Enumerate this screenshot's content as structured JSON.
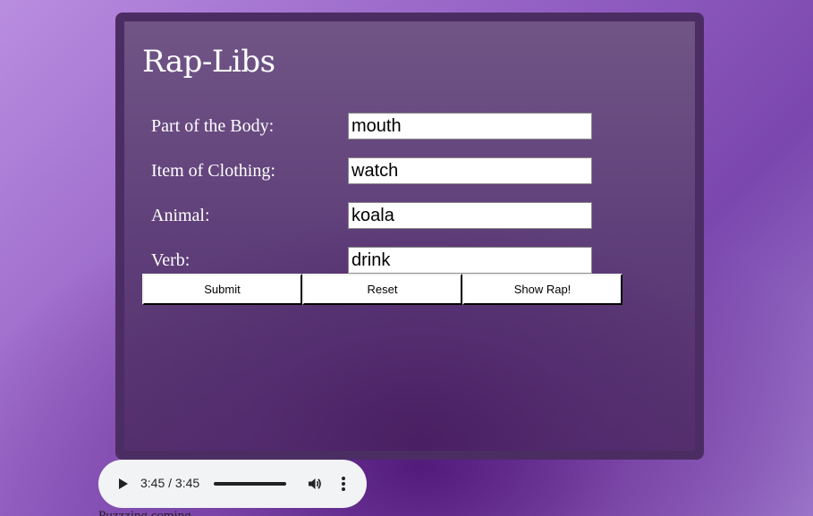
{
  "form": {
    "title": "Rap-Libs",
    "fields": [
      {
        "label": "Part of the Body:",
        "value": "mouth"
      },
      {
        "label": "Item of Clothing:",
        "value": "watch"
      },
      {
        "label": "Animal:",
        "value": "koala"
      },
      {
        "label": "Verb:",
        "value": "drink"
      }
    ],
    "buttons": {
      "submit": "Submit",
      "reset": "Reset",
      "show_rap": "Show Rap!"
    }
  },
  "audio_player": {
    "time": "3:45 / 3:45",
    "progress": 1.0,
    "icons": {
      "play": "play-icon",
      "volume": "volume-icon",
      "more": "more-options-icon"
    }
  },
  "footer": {
    "partial_text": "Puzzzing coming"
  },
  "colors": {
    "page_background": "#9a6cc8",
    "frame": "#4c2d63",
    "panel": "#5e3d78",
    "text": "#ffffff"
  }
}
